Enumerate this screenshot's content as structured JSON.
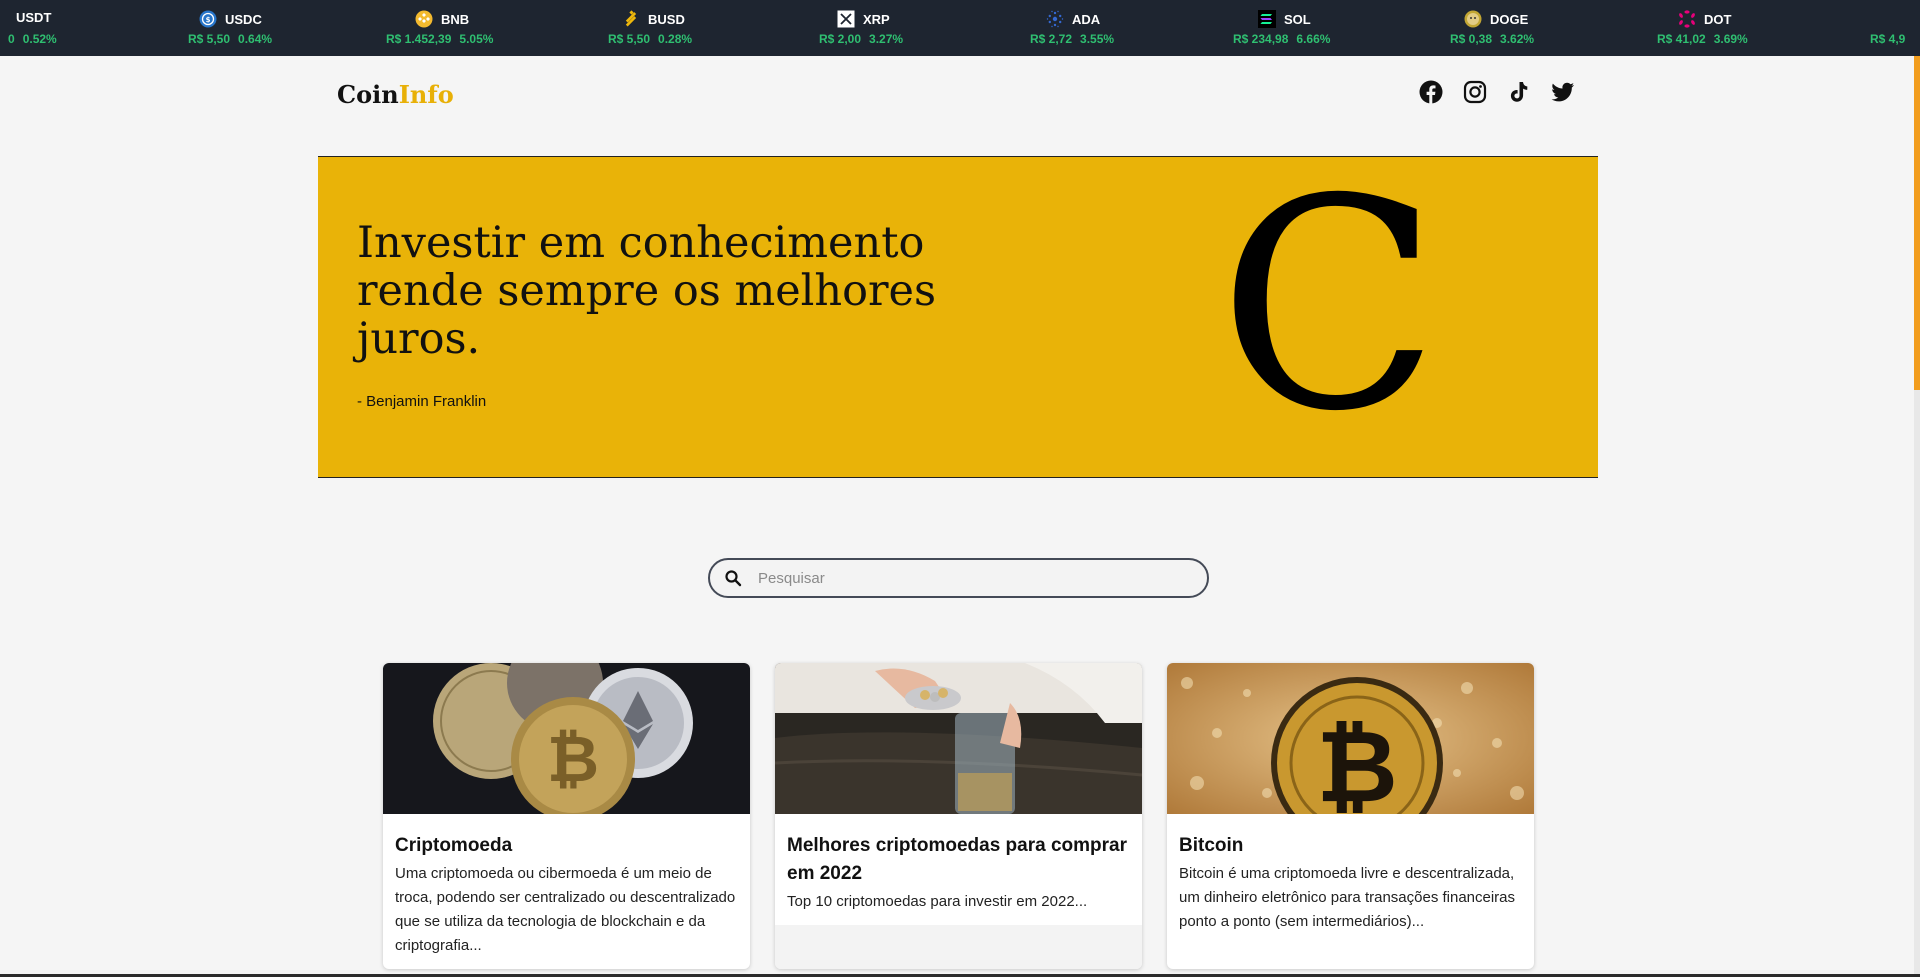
{
  "ticker": [
    {
      "symbol": "USDT",
      "price": "0",
      "change": "0.52%",
      "icon": "tether-icon",
      "color": "#26a17b"
    },
    {
      "symbol": "USDC",
      "price": "R$ 5,50",
      "change": "0.64%",
      "icon": "usdc-icon",
      "color": "#2775ca"
    },
    {
      "symbol": "BNB",
      "price": "R$ 1.452,39",
      "change": "5.05%",
      "icon": "bnb-icon",
      "color": "#f3ba2f"
    },
    {
      "symbol": "BUSD",
      "price": "R$ 5,50",
      "change": "0.28%",
      "icon": "busd-icon",
      "color": "#f0b90b"
    },
    {
      "symbol": "XRP",
      "price": "R$ 2,00",
      "change": "3.27%",
      "icon": "xrp-icon",
      "color": "#ffffff"
    },
    {
      "symbol": "ADA",
      "price": "R$ 2,72",
      "change": "3.55%",
      "icon": "cardano-icon",
      "color": "#3468d1"
    },
    {
      "symbol": "SOL",
      "price": "R$ 234,98",
      "change": "6.66%",
      "icon": "solana-icon",
      "color": "#14f195"
    },
    {
      "symbol": "DOGE",
      "price": "R$ 0,38",
      "change": "3.62%",
      "icon": "doge-icon",
      "color": "#c2a633"
    },
    {
      "symbol": "DOT",
      "price": "R$ 41,02",
      "change": "3.69%",
      "icon": "polkadot-icon",
      "color": "#e6007a"
    },
    {
      "symbol": "",
      "price": "R$ 4,9",
      "change": "",
      "icon": "",
      "color": ""
    }
  ],
  "header": {
    "logo_main": "Coin",
    "logo_accent": "Info",
    "socials": [
      "facebook-icon",
      "instagram-icon",
      "tiktok-icon",
      "twitter-icon"
    ]
  },
  "hero": {
    "quote": "Investir em conhecimento rende sempre os melhores juros.",
    "author": "- Benjamin Franklin",
    "big_letter": "C"
  },
  "search": {
    "placeholder": "Pesquisar"
  },
  "cards": [
    {
      "title": "Criptomoeda",
      "description": "Uma criptomoeda ou cibermoeda é um meio de troca, podendo ser centralizado ou descentralizado que se utiliza da tecnologia de blockchain e da criptografia..."
    },
    {
      "title": "Melhores criptomoedas para comprar em 2022",
      "description": "Top 10 criptomoedas para investir em 2022..."
    },
    {
      "title": "Bitcoin",
      "description": "Bitcoin é uma criptomoeda livre e descentralizada, um dinheiro eletrônico para transações financeiras ponto a ponto (sem intermediários)..."
    }
  ],
  "colors": {
    "ticker_bg": "#1e2530",
    "ticker_up": "#2fbf71",
    "hero_bg": "#e9b308",
    "logo_accent": "#e8b007",
    "scroll_thumb": "#f29d1d"
  }
}
